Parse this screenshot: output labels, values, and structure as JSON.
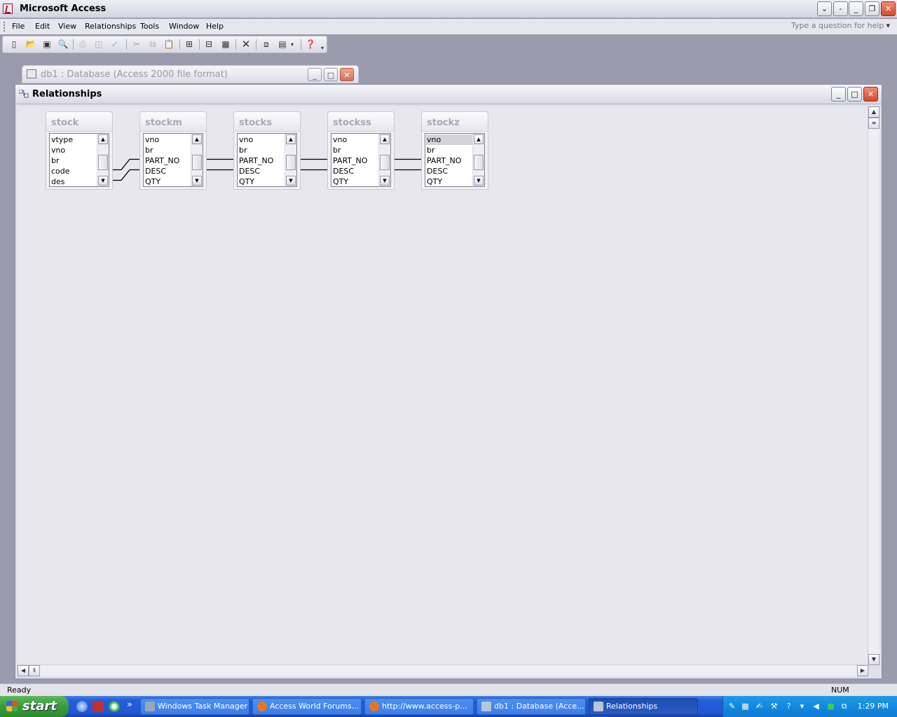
{
  "app": {
    "title": "Microsoft Access"
  },
  "menu": {
    "items": [
      "File",
      "Edit",
      "View",
      "Relationships",
      "Tools",
      "Window",
      "Help"
    ],
    "help_placeholder": "Type a question for help"
  },
  "toolbar": {
    "icons": [
      "new-icon",
      "open-icon",
      "save-icon",
      "file-search-icon",
      "print-icon",
      "print-preview-icon",
      "spelling-icon",
      "cut-icon",
      "copy-icon",
      "paste-icon",
      "show-table-icon",
      "show-direct-icon",
      "show-all-icon",
      "delete-icon",
      "new-object-icon",
      "new-object-dropdown-icon",
      "help-icon",
      "toolbar-options-icon"
    ]
  },
  "db_window": {
    "title": "db1 : Database (Access 2000 file format)"
  },
  "rel_window": {
    "title": "Relationships"
  },
  "tables": [
    {
      "name": "stock",
      "fields": [
        "vtype",
        "vno",
        "br",
        "code",
        "des"
      ],
      "selected": -1
    },
    {
      "name": "stockm",
      "fields": [
        "vno",
        "br",
        "PART_NO",
        "DESC",
        "QTY"
      ],
      "selected": -1
    },
    {
      "name": "stocks",
      "fields": [
        "vno",
        "br",
        "PART_NO",
        "DESC",
        "QTY"
      ],
      "selected": -1
    },
    {
      "name": "stockss",
      "fields": [
        "vno",
        "br",
        "PART_NO",
        "DESC",
        "QTY"
      ],
      "selected": -1
    },
    {
      "name": "stockz",
      "fields": [
        "vno",
        "br",
        "PART_NO",
        "DESC",
        "QTY"
      ],
      "selected": 0
    }
  ],
  "relationships": [
    {
      "from": "stock.code",
      "to": "stockm.PART_NO"
    },
    {
      "from": "stock.des",
      "to": "stockm.DESC"
    },
    {
      "from": "stockm.PART_NO",
      "to": "stocks.PART_NO"
    },
    {
      "from": "stockm.DESC",
      "to": "stocks.DESC"
    },
    {
      "from": "stocks.PART_NO",
      "to": "stockss.PART_NO"
    },
    {
      "from": "stocks.DESC",
      "to": "stockss.DESC"
    },
    {
      "from": "stockss.PART_NO",
      "to": "stockz.PART_NO"
    },
    {
      "from": "stockss.DESC",
      "to": "stockz.DESC"
    }
  ],
  "status": {
    "text": "Ready",
    "num": "NUM"
  },
  "taskbar": {
    "start": "start",
    "overflow": "»",
    "tasks": [
      {
        "label": "Windows Task Manager",
        "icon": "task-manager-icon",
        "color": "#9aa6b8"
      },
      {
        "label": "Access World Forums...",
        "icon": "firefox-icon",
        "color": "#e8742a"
      },
      {
        "label": "http://www.access-p...",
        "icon": "firefox-icon",
        "color": "#e8742a"
      },
      {
        "label": "db1 : Database (Acce...",
        "icon": "database-icon",
        "color": "#b8c4d8"
      },
      {
        "label": "Relationships",
        "icon": "relationships-icon",
        "color": "#b8c4d8"
      }
    ],
    "clock": "1:29 PM"
  }
}
